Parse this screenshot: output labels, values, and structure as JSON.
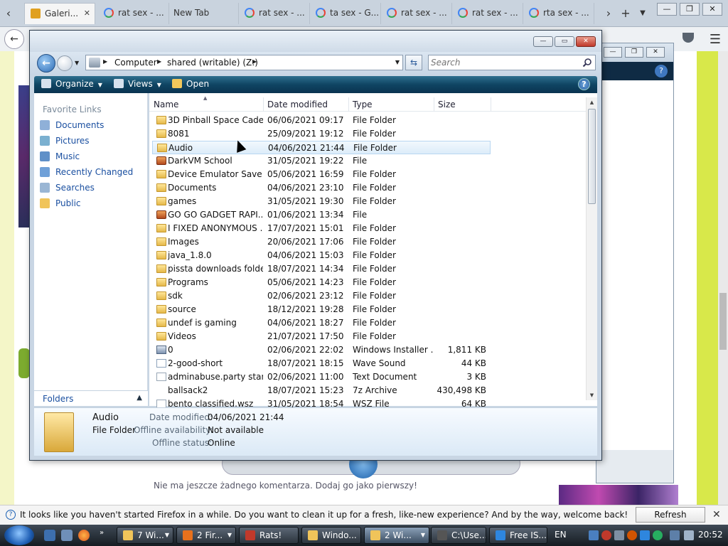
{
  "browser": {
    "tabs": [
      {
        "label": "Galeri...",
        "active": true
      },
      {
        "label": "rat sex - ..."
      },
      {
        "label": "New Tab"
      },
      {
        "label": "rat sex - ..."
      },
      {
        "label": "ta sex - G..."
      },
      {
        "label": "rat sex - ..."
      },
      {
        "label": "rat sex - ..."
      },
      {
        "label": "rta sex - ..."
      }
    ],
    "new_tab_label": "+",
    "notification": {
      "text": "It looks like you haven't started Firefox in a while. Do you want to clean it up for a fresh, like-new experience? And by the way, welcome back!",
      "button_label": "Refresh Firefox...",
      "close_label": "✕"
    }
  },
  "explorer": {
    "breadcrumb": [
      "Computer",
      "shared (writable) (Z:)"
    ],
    "search": {
      "placeholder": "Search"
    },
    "toolbar": {
      "organize": "Organize",
      "views": "Views",
      "open": "Open"
    },
    "favorites": {
      "heading": "Favorite Links",
      "items": [
        {
          "label": "Documents",
          "icon": "documents-icon"
        },
        {
          "label": "Pictures",
          "icon": "pictures-icon"
        },
        {
          "label": "Music",
          "icon": "music-icon"
        },
        {
          "label": "Recently Changed",
          "icon": "recent-icon"
        },
        {
          "label": "Searches",
          "icon": "searches-icon"
        },
        {
          "label": "Public",
          "icon": "public-folder-icon"
        }
      ],
      "folders_label": "Folders"
    },
    "columns": {
      "name": "Name",
      "date": "Date modified",
      "type": "Type",
      "size": "Size"
    },
    "files": [
      {
        "name": "3D Pinball Space Cadet",
        "date": "06/06/2021 09:17",
        "type": "File Folder",
        "size": "",
        "icon": "folder"
      },
      {
        "name": "8081",
        "date": "25/09/2021 19:12",
        "type": "File Folder",
        "size": "",
        "icon": "folder"
      },
      {
        "name": "Audio",
        "date": "04/06/2021 21:44",
        "type": "File Folder",
        "size": "",
        "icon": "folder",
        "selected": true
      },
      {
        "name": "DarkVM School",
        "date": "31/05/2021 19:22",
        "type": "File",
        "size": "",
        "icon": "app"
      },
      {
        "name": "Device Emulator Save ...",
        "date": "05/06/2021 16:59",
        "type": "File Folder",
        "size": "",
        "icon": "folder"
      },
      {
        "name": "Documents",
        "date": "04/06/2021 23:10",
        "type": "File Folder",
        "size": "",
        "icon": "folder"
      },
      {
        "name": "games",
        "date": "31/05/2021 19:30",
        "type": "File Folder",
        "size": "",
        "icon": "folder"
      },
      {
        "name": "GO GO GADGET RAPI...",
        "date": "01/06/2021 13:34",
        "type": "File",
        "size": "",
        "icon": "app"
      },
      {
        "name": "I FIXED ANONYMOUS ...",
        "date": "17/07/2021 15:01",
        "type": "File Folder",
        "size": "",
        "icon": "folder"
      },
      {
        "name": "Images",
        "date": "20/06/2021 17:06",
        "type": "File Folder",
        "size": "",
        "icon": "folder"
      },
      {
        "name": "java_1.8.0",
        "date": "04/06/2021 15:03",
        "type": "File Folder",
        "size": "",
        "icon": "folder"
      },
      {
        "name": "pissta downloads folder",
        "date": "18/07/2021 14:34",
        "type": "File Folder",
        "size": "",
        "icon": "folder"
      },
      {
        "name": "Programs",
        "date": "05/06/2021 14:23",
        "type": "File Folder",
        "size": "",
        "icon": "folder"
      },
      {
        "name": "sdk",
        "date": "02/06/2021 23:12",
        "type": "File Folder",
        "size": "",
        "icon": "folder"
      },
      {
        "name": "source",
        "date": "18/12/2021 19:28",
        "type": "File Folder",
        "size": "",
        "icon": "folder"
      },
      {
        "name": "undef is gaming",
        "date": "04/06/2021 18:27",
        "type": "File Folder",
        "size": "",
        "icon": "folder"
      },
      {
        "name": "Videos",
        "date": "21/07/2021 17:50",
        "type": "File Folder",
        "size": "",
        "icon": "folder"
      },
      {
        "name": "0",
        "date": "02/06/2021 22:02",
        "type": "Windows Installer ...",
        "size": "1,811 KB",
        "icon": "msi"
      },
      {
        "name": "2-good-short",
        "date": "18/07/2021 18:15",
        "type": "Wave Sound",
        "size": "44 KB",
        "icon": "wav"
      },
      {
        "name": "adminabuse.party stan...",
        "date": "02/06/2021 11:00",
        "type": "Text Document",
        "size": "3 KB",
        "icon": "txt"
      },
      {
        "name": "ballsack2",
        "date": "18/07/2021 15:23",
        "type": "7z Archive",
        "size": "430,498 KB",
        "icon": "zip"
      },
      {
        "name": "bento classified.wsz",
        "date": "31/05/2021 18:54",
        "type": "WSZ File",
        "size": "64 KB",
        "icon": "wsz"
      }
    ],
    "details": {
      "name": "Audio",
      "kind": "File Folder",
      "date_label": "Date modified:",
      "date_value": "04/06/2021 21:44",
      "offline_avail_label": "Offline availability:",
      "offline_avail_value": "Not available",
      "offline_status_label": "Offline status:",
      "offline_status_value": "Online"
    }
  },
  "background_page": {
    "comment_text": "Nie ma jeszcze żadnego komentarza. Dodaj go jako pierwszy!"
  },
  "taskbar": {
    "tasks": [
      {
        "label": "7 Wi...",
        "active": false,
        "has_arrow": true
      },
      {
        "label": "2 Fir...",
        "active": false,
        "has_arrow": true
      },
      {
        "label": "Rats!",
        "active": false
      },
      {
        "label": "Windo...",
        "active": false
      },
      {
        "label": "2 Wi...",
        "active": true,
        "has_arrow": true
      },
      {
        "label": "C:\\Use...",
        "active": false
      },
      {
        "label": "Free IS...",
        "active": false
      }
    ],
    "language": "EN",
    "clock": "20:52"
  },
  "colors": {
    "toolbar": "#0f4563",
    "link": "#1a4fa0",
    "selection": "#dcecf9"
  }
}
